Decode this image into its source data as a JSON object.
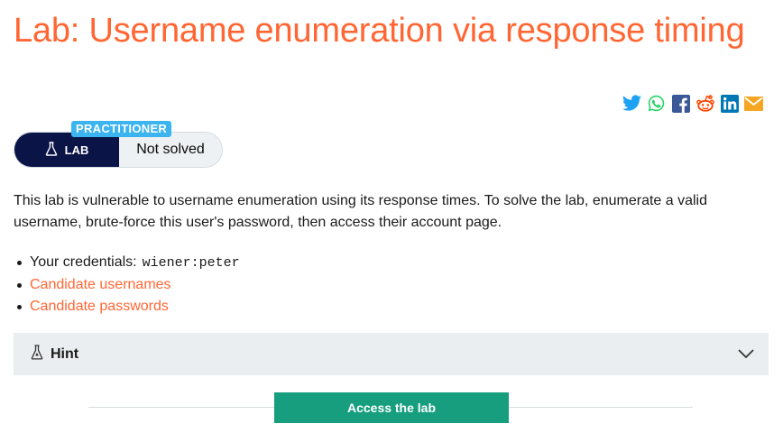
{
  "page": {
    "title": "Lab: Username enumeration via response timing"
  },
  "share": {
    "icons": [
      "twitter-icon",
      "whatsapp-icon",
      "facebook-icon",
      "reddit-icon",
      "linkedin-icon",
      "email-icon"
    ],
    "colors": {
      "twitter": "#1da1f2",
      "whatsapp": "#25d366",
      "facebook": "#3b5998",
      "reddit": "#ff4500",
      "linkedin": "#0077b5",
      "email": "#f5a623"
    }
  },
  "lab_badge": {
    "level": "PRACTITIONER",
    "type_label": "LAB",
    "status": "Not solved"
  },
  "description": "This lab is vulnerable to username enumeration using its response times. To solve the lab, enumerate a valid username, brute-force this user's password, then access their account page.",
  "details": {
    "credentials_label": "Your credentials:",
    "credentials_value": "wiener:peter",
    "candidate_usernames": "Candidate usernames",
    "candidate_passwords": "Candidate passwords"
  },
  "hint": {
    "label": "Hint"
  },
  "cta": {
    "access_label": "Access the lab"
  },
  "colors": {
    "accent": "#ff6633",
    "lab_navy": "#0a1446",
    "practitioner_blue": "#3cb4f0",
    "access_green": "#169e7e",
    "hint_bg": "#ebeef0"
  }
}
